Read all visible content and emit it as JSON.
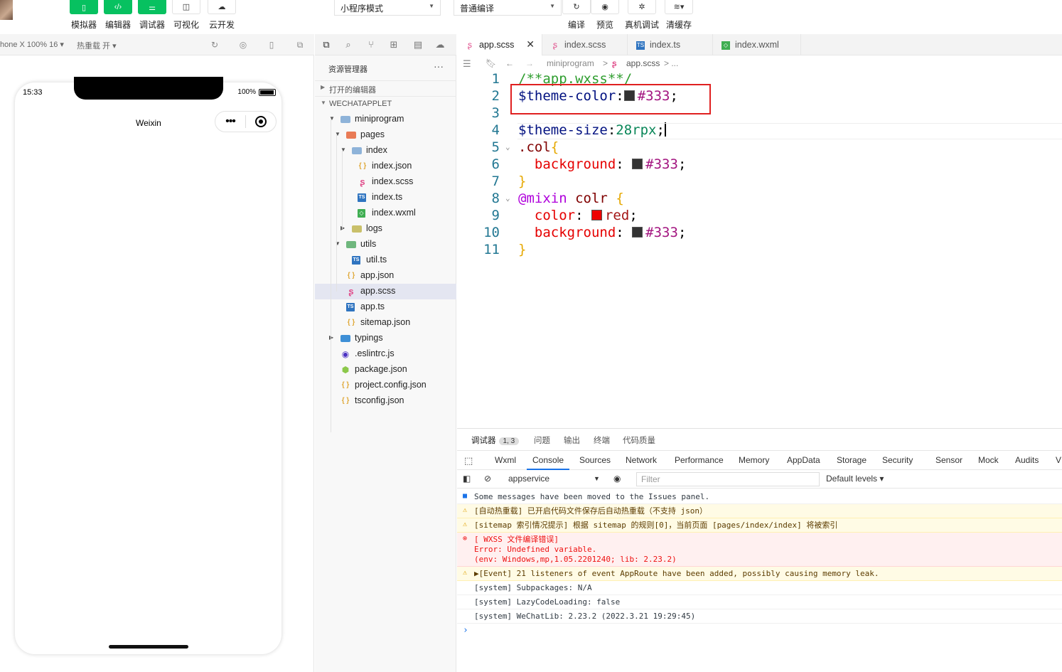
{
  "toolbar": {
    "buttons": [
      {
        "label": "模拟器",
        "icon": "phone-icon"
      },
      {
        "label": "编辑器",
        "icon": "code-icon"
      },
      {
        "label": "调试器",
        "icon": "debug-sliders-icon"
      },
      {
        "label": "可视化",
        "icon": "layout-icon"
      },
      {
        "label": "云开发",
        "icon": "cloud-icon"
      }
    ],
    "mode_select": "小程序模式",
    "compile_select": "普通编译",
    "right_buttons": [
      {
        "label": "编译",
        "icon": "refresh-icon"
      },
      {
        "label": "预览",
        "icon": "eye-icon"
      },
      {
        "label": "真机调试",
        "icon": "bug-icon"
      },
      {
        "label": "清缓存",
        "icon": "layers-icon"
      }
    ]
  },
  "simulator": {
    "device_label": "hone X 100% 16 ▾",
    "hot_reload": "热重载 开 ▾",
    "status_time": "15:33",
    "battery": "100%",
    "nav_title": "Weixin",
    "capsule_dots": "•••"
  },
  "explorer": {
    "title": "资源管理器",
    "more": "···",
    "open_editors": "打开的编辑器",
    "project": "WECHATAPPLET",
    "tree": [
      {
        "name": "miniprogram",
        "depth": 0,
        "type": "folder",
        "open": true
      },
      {
        "name": "pages",
        "depth": 1,
        "type": "folder-pages",
        "open": true
      },
      {
        "name": "index",
        "depth": 2,
        "type": "folder",
        "open": true
      },
      {
        "name": "index.json",
        "depth": 3,
        "type": "json"
      },
      {
        "name": "index.scss",
        "depth": 3,
        "type": "scss"
      },
      {
        "name": "index.ts",
        "depth": 3,
        "type": "ts"
      },
      {
        "name": "index.wxml",
        "depth": 3,
        "type": "wxml"
      },
      {
        "name": "logs",
        "depth": 2,
        "type": "folder-logs",
        "open": false
      },
      {
        "name": "utils",
        "depth": 1,
        "type": "folder-utils",
        "open": true
      },
      {
        "name": "util.ts",
        "depth": 2,
        "type": "ts"
      },
      {
        "name": "app.json",
        "depth": 1,
        "type": "json"
      },
      {
        "name": "app.scss",
        "depth": 1,
        "type": "scss",
        "selected": true
      },
      {
        "name": "app.ts",
        "depth": 1,
        "type": "ts"
      },
      {
        "name": "sitemap.json",
        "depth": 1,
        "type": "json"
      },
      {
        "name": "typings",
        "depth": 0,
        "type": "folder-typings",
        "open": false
      },
      {
        "name": ".eslintrc.js",
        "depth": 0,
        "type": "eslint"
      },
      {
        "name": "package.json",
        "depth": 0,
        "type": "pkg"
      },
      {
        "name": "project.config.json",
        "depth": 0,
        "type": "json"
      },
      {
        "name": "tsconfig.json",
        "depth": 0,
        "type": "json"
      }
    ]
  },
  "editor": {
    "tabs": [
      {
        "name": "app.scss",
        "type": "scss",
        "active": true,
        "close": "✕"
      },
      {
        "name": "index.scss",
        "type": "scss"
      },
      {
        "name": "index.ts",
        "type": "ts"
      },
      {
        "name": "index.wxml",
        "type": "wxml"
      }
    ],
    "breadcrumb": [
      "miniprogram",
      ">",
      "app.scss",
      "> ..."
    ],
    "lines": [
      {
        "n": "1",
        "tokens": [
          [
            "c-comment",
            "/**app.wxss**/"
          ]
        ]
      },
      {
        "n": "2",
        "tokens": [
          [
            "c-var",
            "$theme-color"
          ],
          [
            "c-plain",
            ":"
          ],
          [
            "swatch",
            "#333333"
          ],
          [
            "c-hex",
            "#333"
          ],
          [
            "c-plain",
            ";"
          ]
        ]
      },
      {
        "n": "3",
        "tokens": []
      },
      {
        "n": "4",
        "tokens": [
          [
            "c-var",
            "$theme-size"
          ],
          [
            "c-plain",
            ":"
          ],
          [
            "c-num",
            "28rpx"
          ],
          [
            "c-plain",
            ";"
          ]
        ]
      },
      {
        "n": "5",
        "fold": true,
        "tokens": [
          [
            "c-sel",
            ".col"
          ],
          [
            "c-brace",
            "{"
          ]
        ]
      },
      {
        "n": "6",
        "tokens": [
          [
            "c-plain",
            "  "
          ],
          [
            "c-prop",
            "background"
          ],
          [
            "c-plain",
            ": "
          ],
          [
            "swatch",
            "#333333"
          ],
          [
            "c-hex",
            "#333"
          ],
          [
            "c-plain",
            ";"
          ]
        ]
      },
      {
        "n": "7",
        "tokens": [
          [
            "c-brace",
            "}"
          ]
        ]
      },
      {
        "n": "8",
        "fold": true,
        "tokens": [
          [
            "c-at",
            "@mixin"
          ],
          [
            "c-plain",
            " "
          ],
          [
            "c-sel",
            "colr"
          ],
          [
            "c-plain",
            " "
          ],
          [
            "c-brace",
            "{"
          ]
        ]
      },
      {
        "n": "9",
        "tokens": [
          [
            "c-plain",
            "  "
          ],
          [
            "c-prop",
            "color"
          ],
          [
            "c-plain",
            ": "
          ],
          [
            "swatch",
            "#ee0000"
          ],
          [
            "c-red",
            "red"
          ],
          [
            "c-plain",
            ";"
          ]
        ]
      },
      {
        "n": "10",
        "tokens": [
          [
            "c-plain",
            "  "
          ],
          [
            "c-prop",
            "background"
          ],
          [
            "c-plain",
            ": "
          ],
          [
            "swatch",
            "#333333"
          ],
          [
            "c-hex",
            "#333"
          ],
          [
            "c-plain",
            ";"
          ]
        ]
      },
      {
        "n": "11",
        "tokens": [
          [
            "c-brace",
            "}"
          ]
        ]
      }
    ]
  },
  "debug": {
    "panel_tabs": [
      "调试器",
      "问题",
      "输出",
      "终端",
      "代码质量"
    ],
    "badge": "1, 3",
    "devtools_tabs": [
      "Wxml",
      "Console",
      "Sources",
      "Network",
      "Performance",
      "Memory",
      "AppData",
      "Storage",
      "Security",
      "Sensor",
      "Mock",
      "Audits",
      "V"
    ],
    "active_devtool": "Console",
    "context": "appservice",
    "filter_placeholder": "Filter",
    "levels": "Default levels ▾",
    "messages": [
      {
        "level": "info",
        "icon": "■",
        "text": "Some messages have been moved to the Issues panel."
      },
      {
        "level": "warn",
        "icon": "⚠",
        "text": "[自动热重载] 已开启代码文件保存后自动热重载（不支持 json）"
      },
      {
        "level": "warn",
        "icon": "⚠",
        "text": "[sitemap 索引情况提示] 根据 sitemap 的规则[0]，当前页面 [pages/index/index] 将被索引"
      },
      {
        "level": "err",
        "icon": "⊗",
        "text": "[ WXSS 文件编译错误]\nError: Undefined variable.\n(env: Windows,mp,1.05.2201240; lib: 2.23.2)"
      },
      {
        "level": "warn",
        "icon": "⚠",
        "text": "▶[Event] 21 listeners of event AppRoute have been added, possibly causing memory leak."
      },
      {
        "level": "info",
        "icon": "",
        "text": "[system] Subpackages: N/A"
      },
      {
        "level": "info",
        "icon": "",
        "text": "[system] LazyCodeLoading: false"
      },
      {
        "level": "info",
        "icon": "",
        "text": "[system] WeChatLib: 2.23.2 (2022.3.21 19:29:45)"
      }
    ],
    "prompt": "›"
  }
}
